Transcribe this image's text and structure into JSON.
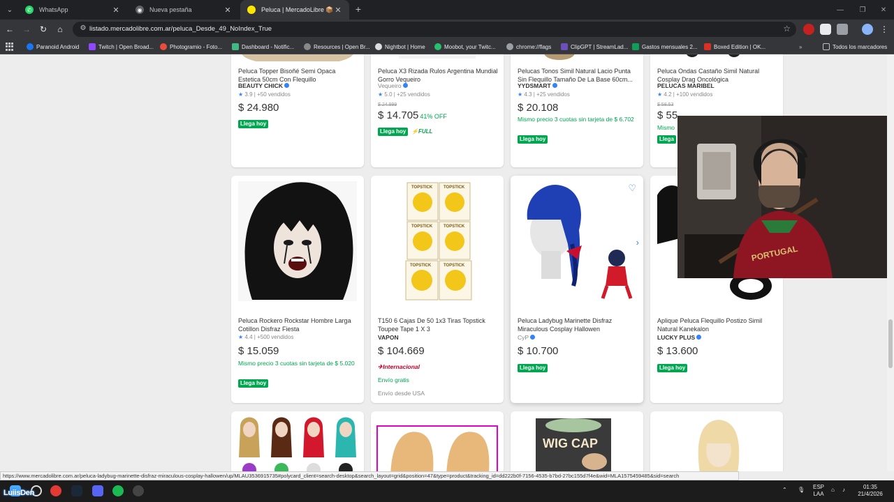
{
  "colors": {
    "accent": "#3483fa",
    "green": "#00a650",
    "red": "#c4002b"
  },
  "tabs": [
    {
      "title": "WhatsApp",
      "icon": "whatsapp-icon",
      "active": false
    },
    {
      "title": "Nueva pestaña",
      "icon": "chrome-icon",
      "active": false
    },
    {
      "title": "Peluca | MercadoLibre 📦",
      "icon": "mercadolibre-icon",
      "active": true
    }
  ],
  "address": {
    "url": "listado.mercadolibre.com.ar/peluca_Desde_49_NoIndex_True"
  },
  "bookmarks": [
    "Paranoid Android",
    "Twitch | Open Broad...",
    "Photogramio - Foto...",
    "Dashboard - Notific...",
    "Resources | Open Br...",
    "Nightbot | Home",
    "Moobot, your Twitc...",
    "chrome://flags",
    "ClipGPT | StreamLad...",
    "Gastos mensuales 2...",
    "Boxed Edition | OK..."
  ],
  "bookmarks_other": "Todos los marcadores",
  "row1": [
    {
      "title": "Peluca Topper Bisoñé Semi Opaca Estetica 50cm Con Flequillo",
      "seller": "BEAUTY CHICK",
      "verified": true,
      "rating": "3.9",
      "sold": "| +50 vendidos",
      "price": "$ 24.980",
      "badge": "Llega hoy"
    },
    {
      "title": "Peluca X3 Rizada Rulos Argentina Mundial Gorro Vequeiro",
      "seller": "Vequeiro",
      "verified": true,
      "rating": "5.0",
      "sold": "| +25 vendidos",
      "oldprice": "$ 24.999",
      "price": "$ 14.705",
      "off": "41% OFF",
      "badge": "Llega hoy",
      "full": "FULL"
    },
    {
      "title": "Pelucas Tonos Simil Natural Lacio Punta Sin Flequillo Tamaño De La Base 60cm...",
      "seller": "YYDSMART",
      "verified": true,
      "rating": "4.3",
      "sold": "| +25 vendidos",
      "price": "$ 20.108",
      "cuotas": "Mismo precio 3 cuotas sin tarjeta de $ 6.702",
      "badge": "Llega hoy"
    },
    {
      "title": "Peluca Ondas Castaño Simil Natural Cosplay Drag Oncológica",
      "seller": "PELUCAS MARIBEL",
      "rating": "4.2",
      "sold": "| +100 vendidos",
      "oldprice": "$ 58.53",
      "price": "$ 55",
      "cuotas": "Mismo",
      "badge": "Llega"
    }
  ],
  "row2": [
    {
      "title": "Peluca Rockero Rockstar Hombre Larga Cotillon Disfraz Fiesta",
      "rating": "4.4",
      "sold": "| +500 vendidos",
      "price": "$ 15.059",
      "cuotas": "Mismo precio 3 cuotas sin tarjeta de $ 5.020",
      "badge": "Llega hoy"
    },
    {
      "title": "T150 6 Cajas De 50 1x3 Tiras Topstick Toupee Tape 1 X 3",
      "seller": "VAPON",
      "price": "$ 104.669",
      "intl": "Internacional",
      "envio": "Envío gratis",
      "envio_usa": "Envío desde USA",
      "box_label": "TOPSTICK"
    },
    {
      "title": "Peluca Ladybug Marinette Disfraz Miraculous Cosplay Hallowen",
      "seller": "CyP",
      "verified": true,
      "price": "$ 10.700",
      "badge": "Llega hoy"
    },
    {
      "title": "Aplique Peluca Flequillo Postizo Simil Natural Kanekalon",
      "seller": "LUCKY PLUS",
      "verified": true,
      "price": "$ 13.600",
      "badge": "Llega hoy"
    }
  ],
  "row3": {
    "wigcap_label": "WIG CAP"
  },
  "status_url": "https://www.mercadolibre.com.ar/peluca-ladybug-marinette-disfraz-miraculous-cosplay-hallowen/up/MLAU3536915735#polycard_client=search-desktop&search_layout=grid&position=47&type=product&tracking_id=dd222b0f-7156-4535-b7bd-27bc155d7f4e&wid=MLA1575459485&sid=search",
  "taskbar": {
    "lang": "ESP",
    "layout": "LAA",
    "time": "01:35",
    "date": "21/4/2026",
    "overlay": "LuiisDen"
  },
  "webcam": {
    "shirt_text": "PORTUGAL"
  }
}
